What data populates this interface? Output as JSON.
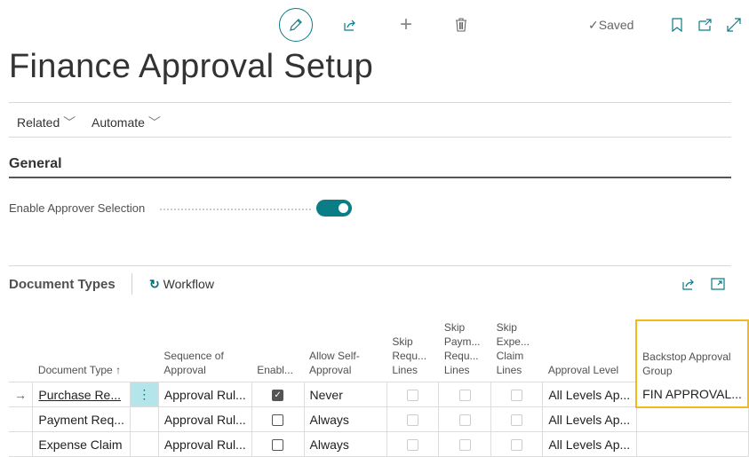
{
  "toolbar": {
    "saved_label": "Saved"
  },
  "page": {
    "title": "Finance Approval Setup"
  },
  "menu": {
    "related": "Related",
    "automate": "Automate"
  },
  "general": {
    "heading": "General",
    "enable_approver_selection_label": "Enable Approver Selection",
    "enable_approver_selection": true
  },
  "doc_types": {
    "heading": "Document Types",
    "workflow_label": "Workflow",
    "columns": [
      "Document Type ↑",
      "Sequence of Approval",
      "Enabl...",
      "Allow Self-Approval",
      "Skip Requ... Lines",
      "Skip Paym... Requ... Lines",
      "Skip Expe... Claim Lines",
      "Approval Level",
      "Backstop Approval Group"
    ],
    "rows": [
      {
        "doc_type": "Purchase Re...",
        "sequence": "Approval Rul...",
        "enabled": true,
        "allow_self": "Never",
        "level": "All Levels Ap...",
        "backstop": "FIN APPROVAL..."
      },
      {
        "doc_type": "Payment Req...",
        "sequence": "Approval Rul...",
        "enabled": false,
        "allow_self": "Always",
        "level": "All Levels Ap...",
        "backstop": ""
      },
      {
        "doc_type": "Expense Claim",
        "sequence": "Approval Rul...",
        "enabled": false,
        "allow_self": "Always",
        "level": "All Levels Ap...",
        "backstop": ""
      }
    ]
  },
  "colors": {
    "accent": "#00707a",
    "focus": "#f5b819",
    "row_action": "#b3e5ea"
  }
}
